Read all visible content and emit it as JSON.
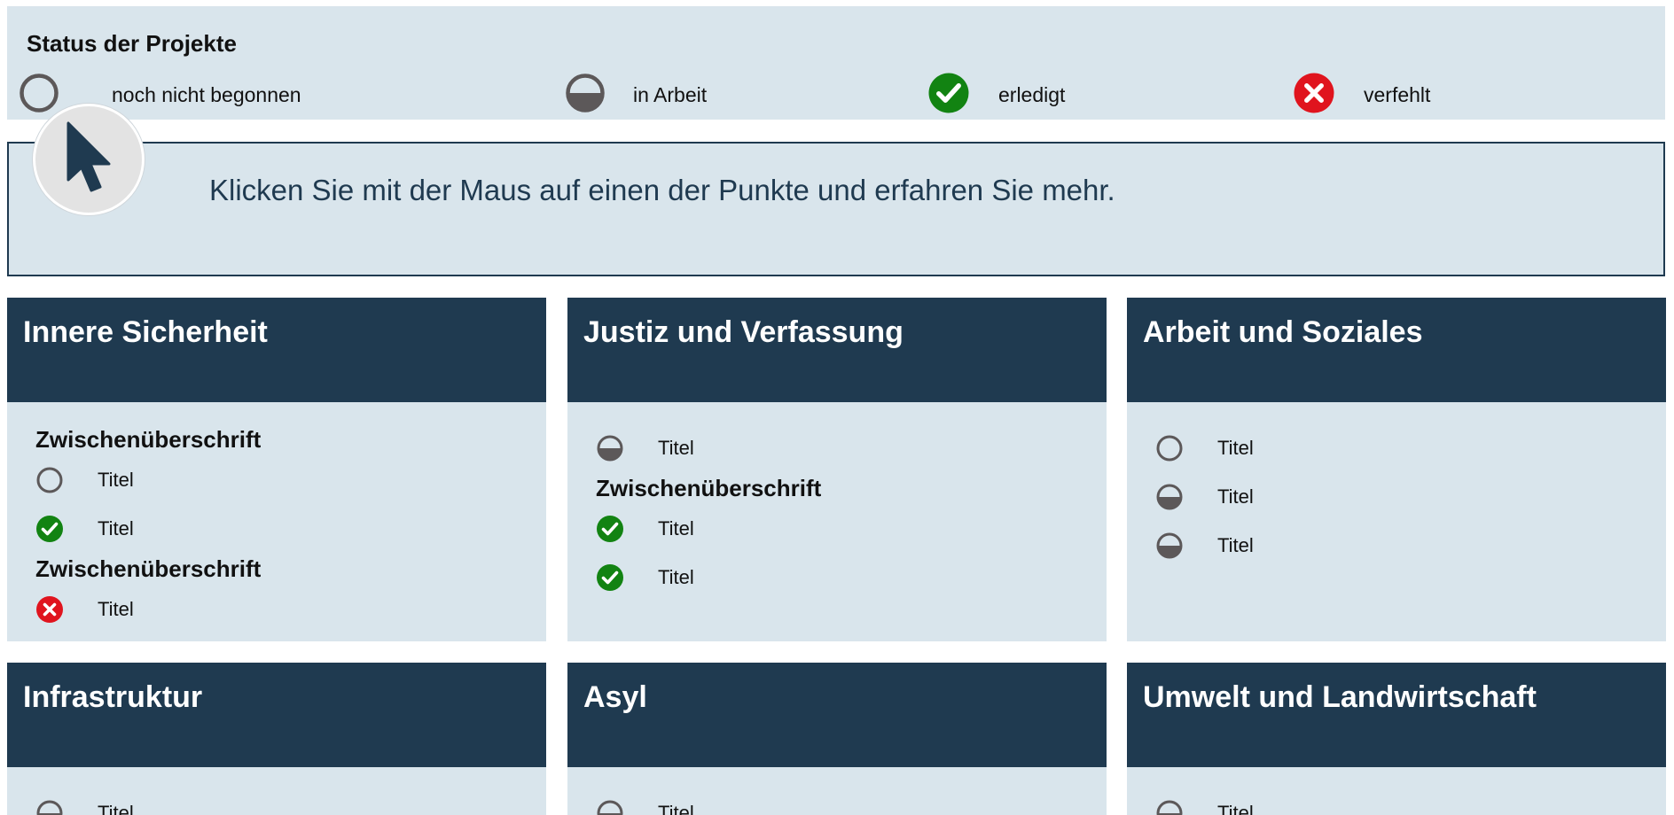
{
  "legend": {
    "title": "Status der Projekte",
    "items": [
      {
        "status": "open",
        "label": "noch nicht begonnen"
      },
      {
        "status": "half",
        "label": "in Arbeit"
      },
      {
        "status": "done",
        "label": "erledigt"
      },
      {
        "status": "fail",
        "label": "verfehlt"
      }
    ]
  },
  "info": {
    "text": "Klicken Sie mit der Maus auf einen der Punkte und erfahren Sie mehr."
  },
  "colors": {
    "navy": "#1f3a50",
    "panel": "#d9e5ec",
    "done": "#128312",
    "fail": "#e0141e",
    "status_gray": "#5c5859"
  },
  "cards": [
    {
      "title": "Innere Sicherheit",
      "rows": [
        {
          "kind": "sub",
          "text": "Zwischenüberschrift"
        },
        {
          "kind": "item",
          "status": "open",
          "text": "Titel"
        },
        {
          "kind": "item",
          "status": "done",
          "text": "Titel"
        },
        {
          "kind": "sub",
          "text": "Zwischenüberschrift"
        },
        {
          "kind": "item",
          "status": "fail",
          "text": "Titel"
        }
      ]
    },
    {
      "title": "Justiz und Verfassung",
      "rows": [
        {
          "kind": "item",
          "status": "half",
          "text": "Titel"
        },
        {
          "kind": "sub",
          "text": "Zwischenüberschrift"
        },
        {
          "kind": "item",
          "status": "done",
          "text": "Titel"
        },
        {
          "kind": "item",
          "status": "done",
          "text": "Titel"
        }
      ]
    },
    {
      "title": "Arbeit und Soziales",
      "rows": [
        {
          "kind": "item",
          "status": "open",
          "text": "Titel"
        },
        {
          "kind": "item",
          "status": "half",
          "text": "Titel"
        },
        {
          "kind": "item",
          "status": "half",
          "text": "Titel"
        }
      ]
    },
    {
      "title": "Infrastruktur",
      "rows": [
        {
          "kind": "item",
          "status": "half",
          "text": "Titel"
        }
      ]
    },
    {
      "title": "Asyl",
      "rows": [
        {
          "kind": "item",
          "status": "half",
          "text": "Titel"
        }
      ]
    },
    {
      "title": "Umwelt und Landwirtschaft",
      "rows": [
        {
          "kind": "item",
          "status": "half",
          "text": "Titel"
        }
      ]
    }
  ]
}
